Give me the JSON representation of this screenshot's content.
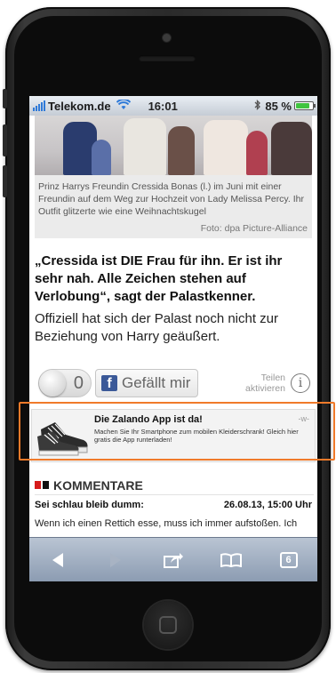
{
  "statusbar": {
    "carrier": "Telekom.de",
    "time": "16:01",
    "battery": "85 %",
    "battery_level": 0.85,
    "battery_color": "#3fc43f"
  },
  "article": {
    "caption": "Prinz Harrys Freundin Cressida Bonas (l.) im Juni mit einer Freundin auf dem Weg zur Hochzeit von Lady Melissa Percy. Ihr Outfit glitzerte wie eine Weihnachtskugel",
    "credit": "Foto: dpa Picture-Alliance",
    "headline": "„Cressida ist DIE Frau für ihn. Er ist ihr sehr nah. Alle Zeichen stehen auf Verlobung“, sagt der Palastkenner.",
    "body": "Offiziell hat sich der Palast noch nicht zur Beziehung von Harry geäußert."
  },
  "social": {
    "count": "0",
    "like_label": "Gefällt mir",
    "fb_letter": "f",
    "share_label_1": "Teilen",
    "share_label_2": "aktivieren",
    "info_glyph": "i",
    "facebook_color": "#3b5998"
  },
  "ad": {
    "title": "Die Zalando App ist da!",
    "tag": "-w-",
    "description": "Machen Sie Ihr Smartphone zum mobilen Kleiderschrank! Gleich hier gratis die App runterladen!",
    "image_icon": "sneaker-icon",
    "highlight_color": "#f07a2a"
  },
  "comments": {
    "section_title": "KOMMENTARE",
    "accent_color": "#d61b1b",
    "items": [
      {
        "author": "Sei schlau bleib dumm:",
        "date": "26.08.13, 15:00 Uhr",
        "text": "Wenn ich einen Rettich esse, muss ich immer aufstoßen. Ich"
      }
    ]
  },
  "toolbar": {
    "back_icon": "back-arrow-icon",
    "forward_icon": "forward-arrow-icon",
    "share_icon": "share-icon",
    "bookmarks_icon": "bookmarks-icon",
    "tabs_count": "6"
  }
}
